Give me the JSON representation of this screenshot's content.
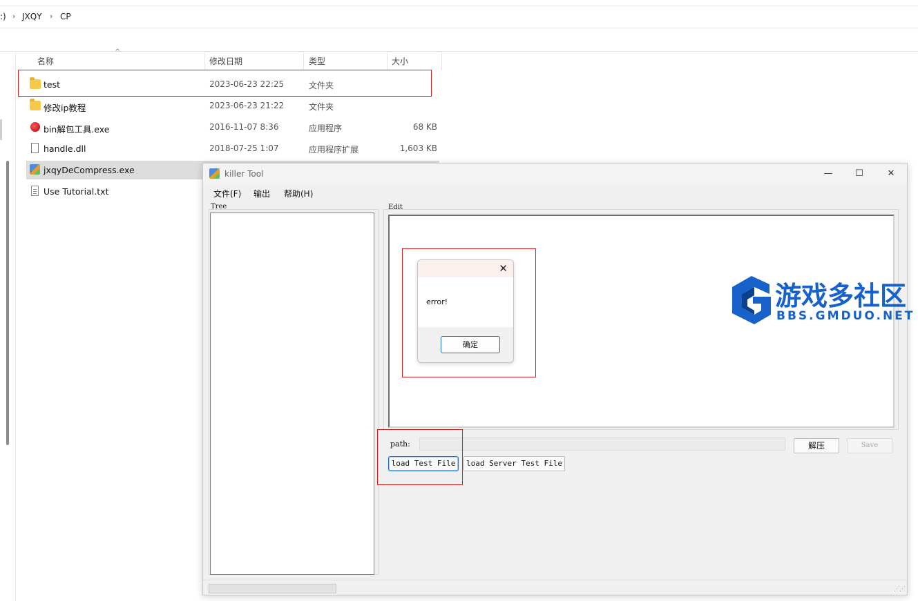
{
  "explorer": {
    "breadcrumb": [
      ":)",
      "JXQY",
      "CP"
    ],
    "columns": {
      "name": "名称",
      "date": "修改日期",
      "type": "类型",
      "size": "大小"
    },
    "files": [
      {
        "name": "test",
        "date": "2023-06-23 22:25",
        "type": "文件夹",
        "size": "",
        "icon": "folder-icon"
      },
      {
        "name": "修改ip教程",
        "date": "2023-06-23 21:22",
        "type": "文件夹",
        "size": "",
        "icon": "folder-icon"
      },
      {
        "name": "bin解包工具.exe",
        "date": "2016-11-07 8:36",
        "type": "应用程序",
        "size": "68 KB",
        "icon": "exe-icon"
      },
      {
        "name": "handle.dll",
        "date": "2018-07-25 1:07",
        "type": "应用程序扩展",
        "size": "1,603 KB",
        "icon": "dll-icon"
      },
      {
        "name": "jxqyDeCompress.exe",
        "date": "",
        "type": "",
        "size": "",
        "icon": "app-icon"
      },
      {
        "name": "Use Tutorial.txt",
        "date": "",
        "type": "",
        "size": "",
        "icon": "text-file-icon"
      }
    ]
  },
  "tool_window": {
    "title": "killer Tool",
    "controls": {
      "minimize": "—",
      "maximize": "☐",
      "close": "✕"
    },
    "menu": [
      "文件(F)",
      "输出",
      "帮助(H)"
    ],
    "tree_label": "Tree",
    "edit_label": "Edit",
    "path_label": "path:",
    "path_value": "",
    "decompress_button": "解压",
    "save_button": "Save",
    "load_test_button": "load Test File",
    "load_server_button": "load Server Test File"
  },
  "dialog": {
    "message": "error!",
    "ok_button": "确定",
    "close_glyph": "✕"
  },
  "watermark": {
    "chinese": "游戏多社区",
    "url": "BBS.GMDUO.NET",
    "color": "#1762c8"
  },
  "colors": {
    "highlight_box": "#d81e1e",
    "selected_row": "#dcdcdc",
    "accent": "#1a6fcf"
  }
}
